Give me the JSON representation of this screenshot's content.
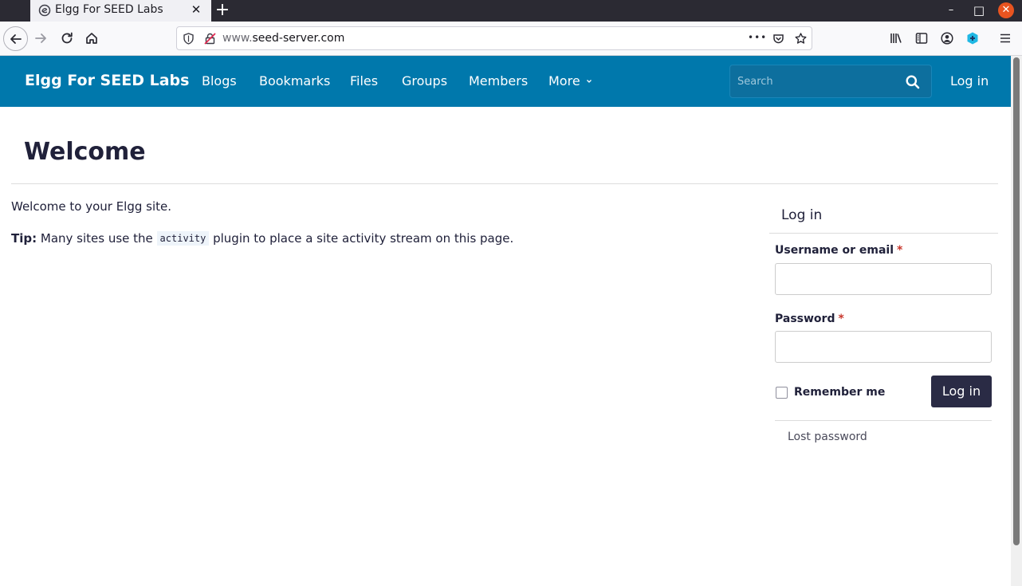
{
  "browser": {
    "tab_title": "Elgg For SEED Labs",
    "url_prefix": "www.",
    "url_domain": "seed-server.com",
    "close_glyph": "✕",
    "newtab_glyph": "+",
    "win_min_glyph": "–",
    "win_max_glyph": "□",
    "win_close_glyph": "✕",
    "page_actions_glyph": "•••"
  },
  "site": {
    "brand": "Elgg For SEED Labs",
    "menu": [
      {
        "label": "Blogs"
      },
      {
        "label": "Bookmarks"
      },
      {
        "label": "Files"
      },
      {
        "label": "Groups"
      },
      {
        "label": "Members"
      },
      {
        "label": "More"
      }
    ],
    "search_placeholder": "Search",
    "login_link": "Log in"
  },
  "main": {
    "title": "Welcome",
    "intro": "Welcome to your Elgg site.",
    "tip_label": "Tip:",
    "tip_before": " Many sites use the ",
    "tip_code": "activity",
    "tip_after": " plugin to place a site activity stream on this page."
  },
  "login_box": {
    "title": "Log in",
    "username_label": "Username or email",
    "password_label": "Password",
    "required_mark": "*",
    "remember_label": "Remember me",
    "submit_label": "Log in",
    "lost_password": "Lost password"
  },
  "colors": {
    "brand_bar": "#0078ac",
    "button_dark": "#2a2b45",
    "text_dark": "#20213a"
  }
}
